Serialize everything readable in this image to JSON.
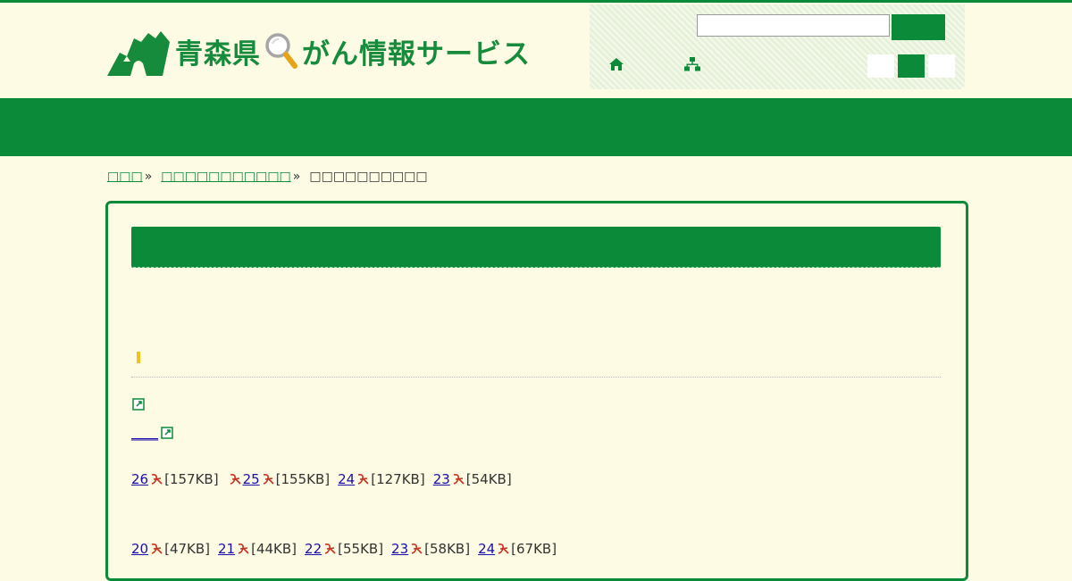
{
  "header": {
    "logo_text_pre": "青森県",
    "logo_text_post": "がん情報サービス"
  },
  "search": {
    "input_value": "",
    "placeholder": "",
    "button_label": ""
  },
  "utility": {
    "home_label": "",
    "sitemap_label": "",
    "font_small_label": "",
    "font_medium_label": "",
    "font_large_label": ""
  },
  "breadcrumb": {
    "items": [
      {
        "label": "□□□"
      },
      {
        "label": "□□□□□□□□□□□"
      }
    ],
    "separator": "»",
    "current": "□□□□□□□□□□"
  },
  "page": {
    "title": "",
    "section_heading": "",
    "external_link_1": "",
    "external_link_2": "____"
  },
  "files_row_1": [
    {
      "label": "26",
      "size": "[157KB]"
    },
    {
      "label": "25",
      "size": "[155KB]"
    },
    {
      "label": "24",
      "size": "[127KB]"
    },
    {
      "label": "23",
      "size": "[54KB]"
    }
  ],
  "files_row_2": [
    {
      "label": "20",
      "size": "[47KB]"
    },
    {
      "label": "21",
      "size": "[44KB]"
    },
    {
      "label": "22",
      "size": "[55KB]"
    },
    {
      "label": "23",
      "size": "[58KB]"
    },
    {
      "label": "24",
      "size": "[67KB]"
    }
  ],
  "icons": {
    "home": "home-icon",
    "sitemap": "sitemap-icon",
    "external": "external-link-icon",
    "pdf": "pdf-icon",
    "magnifier": "magnifier-icon"
  },
  "colors": {
    "brand_green": "#0b8a3a",
    "page_background": "#fdfbe3",
    "heading_marker": "#f2c21b",
    "link_blue": "#1a0dab"
  }
}
